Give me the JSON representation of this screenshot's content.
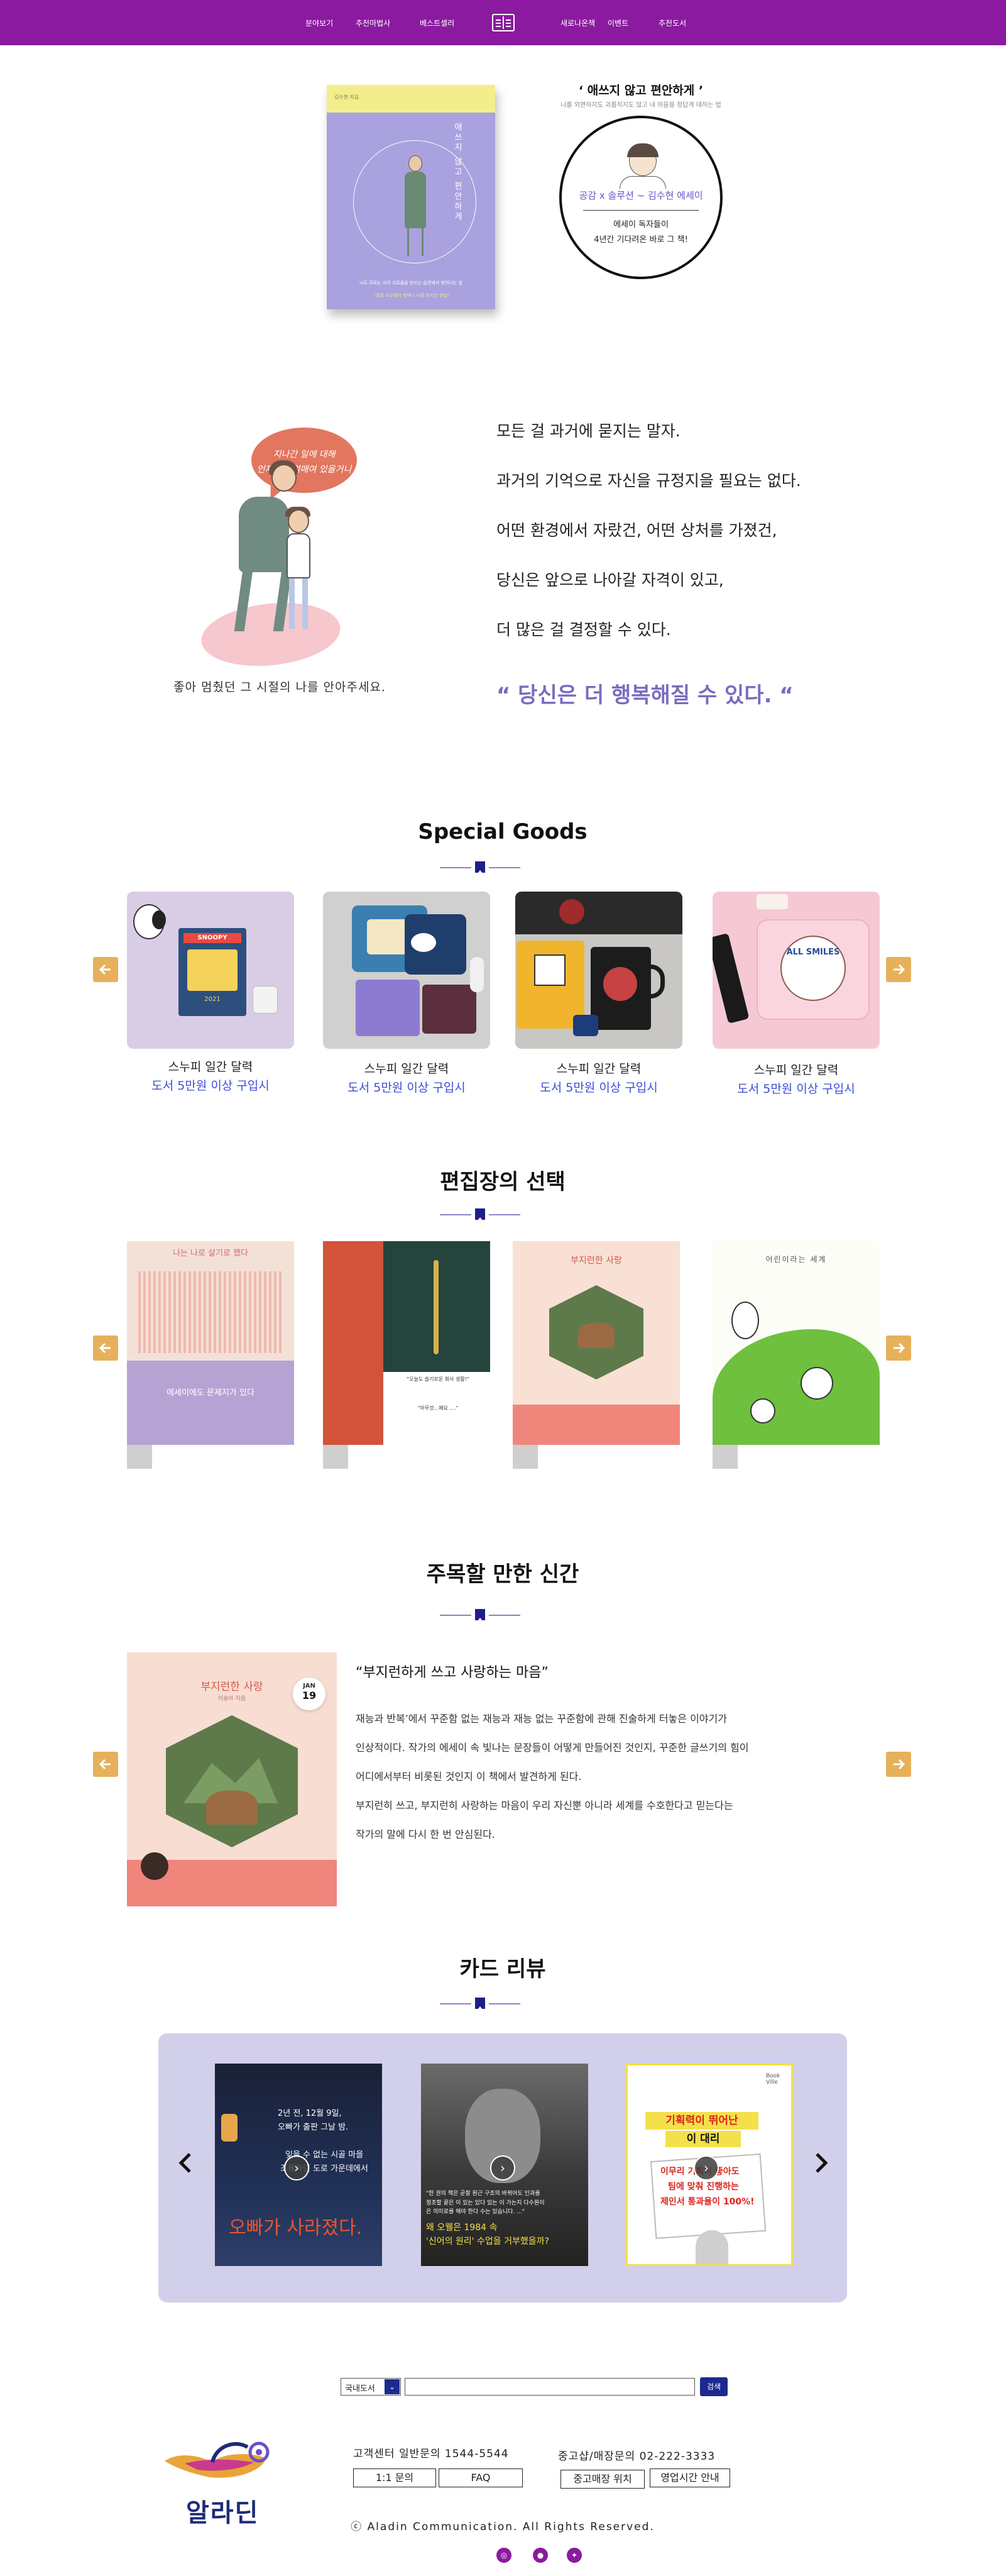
{
  "nav": {
    "left": [
      "분야보기",
      "추천마법사",
      "베스트셀러"
    ],
    "right": [
      "새로나온책",
      "이벤트",
      "추천도서"
    ]
  },
  "hero": {
    "title": "‘ 애쓰지 않고 편안하게 ’",
    "subtitle": "나를 외면하지도 괴롭히지도 않고 내 마음을 정답게 대하는 법",
    "cover_title": "애쓰지 않고 편안하게",
    "cover_author": "김수현 지음",
    "cover_desc": "나도 모르는 사이 괴로움을 만드는 습관에서 벗어나는 법",
    "cover_highlight": "\"감정 소모에서 벗어나 나를 지키는 연습\"",
    "circle_line1": "공감 x 솔루션 ~ 김수현 에세이",
    "circle_line2": "에세이 독자들이",
    "circle_line3": "4년간 기다려온 바로 그 책!"
  },
  "quote": {
    "bubble_lines": [
      "지나간 일에 대해",
      "언제까지 얽매여 있을거니"
    ],
    "caption": "좋아 멈췄던 그 시절의 나를 안아주세요.",
    "lines": [
      "모든 걸 과거에 묻지는 말자.",
      "과거의 기억으로 자신을 규정지을 필요는 없다.",
      "어떤 환경에서 자랐건, 어떤 상처를 가졌건,",
      "당신은 앞으로 나아갈 자격이 있고,",
      "더 많은 걸 결정할 수 있다."
    ],
    "emphasis": "“ 당신은 더 행복해질 수 있다. “"
  },
  "special_goods": {
    "title": "Special Goods",
    "items": [
      {
        "name": "스누피 일간 달력",
        "promo": "도서 5만원 이상 구입시"
      },
      {
        "name": "스누피 일간 달력",
        "promo": "도서 5만원 이상 구입시"
      },
      {
        "name": "스누피 일간 달력",
        "promo": "도서 5만원 이상 구입시"
      },
      {
        "name": "스누피 일간 달력",
        "promo": "도서 5만원 이상 구입시"
      }
    ],
    "snoopy_label": "SNOOPY",
    "year_label": "2021",
    "pouch_label": "ALL SMILES"
  },
  "editor_pick": {
    "title": "편집장의 선택",
    "book1_title": "나는 나로 살기로 했다",
    "book1_sub": "에세이에도 문제지가 있다",
    "book2_quote": "\"오늘도 슬기로운 회사 생활!\"",
    "book2_line": "\"아무것...예요 ....\"",
    "book3_title": "부지런한 사랑",
    "book4_title": "어린이라는 세계"
  },
  "new_book": {
    "title": "주목할 만한 신간",
    "cover_title": "부지런한 사랑",
    "cover_author": "이슬아 지음",
    "date_month": "JAN",
    "date_day": "19",
    "quote_title": "“부지런하게 쓰고 사랑하는 마음”",
    "paragraphs": [
      "재능과 반복’에서 꾸준함 없는 재능과 재능 없는 꾸준함에 관해 진술하게 터놓은 이야기가",
      "인상적이다. 작가의 에세이 속 빛나는 문장들이 어떻게 만들어진 것인지, 꾸준한 글쓰기의 힘이",
      "어디에서부터 비롯된 것인지 이 책에서 발견하게 된다.",
      "부지런히 쓰고, 부지런히 사랑하는 마음이 우리 자신뿐 아니라 세계를 수호한다고 믿는다는",
      "작가의 말에 다시 한 번 안심된다."
    ]
  },
  "card_review": {
    "title": "카드 리뷰",
    "card1_lines": [
      "2년 전, 12월 9일,",
      "오빠가 출판 그날 밤.",
      "",
      "잊을 수 없는 시골 마을",
      "조용하던 도로 가운데에서"
    ],
    "card1_big": "오빠가 사라졌다.",
    "card2_lines": [
      "\"한 권의 책은 곧잘 원근 구조의 바뀌어도 인과를",
      "정조할 끝은 이 있는 있다 있는 이 가는지 다수원이",
      "은 의미로를 해야 한다 수는 있습니다. ...\"",
      "왜 오웰은 1984 속",
      "'신어의 원리' 수업을 거부했을까?"
    ],
    "card3_banner1": "기획력이 뛰어난",
    "card3_banner2": "이 대리",
    "card3_body": [
      "이무리 기획이 좋아도",
      "팀에 맞춰 진행하는",
      "제인서 통과율이 100%!"
    ],
    "card3_tag": "Book Ville"
  },
  "footer": {
    "search_select": "국내도서",
    "search_button": "검색",
    "customer_center": "고객센터 일반문의 1544-5544",
    "used_shop": "중고샵/매장문의 02-222-3333",
    "btn_inquiry": "1:1 문의",
    "btn_faq": "FAQ",
    "btn_store": "중고매장 위치",
    "btn_hours": "영업시간 안내",
    "brand": "알라딘",
    "copyright": "ⓒ Aladin Communication. All Rights Reserved.",
    "social": [
      "instagram-icon",
      "kakao-icon",
      "twitter-icon"
    ]
  },
  "colors": {
    "nav_bg": "#8b1aa0",
    "accent_purple": "#7b6bc0",
    "promo_blue": "#3c4ed6",
    "arrow_orange": "#e6b15a",
    "review_bg": "#d2cfea",
    "navy": "#1c2a8f"
  }
}
